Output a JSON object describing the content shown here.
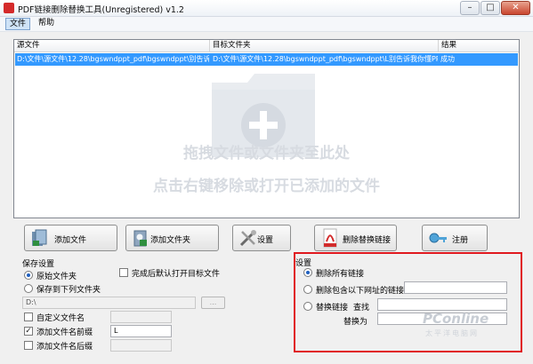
{
  "window": {
    "title": "PDF链接删除替换工具(Unregistered) v1.2",
    "minimize_glyph": "–",
    "maximize_glyph": "□",
    "close_glyph": "✕"
  },
  "menu": {
    "items": [
      "文件",
      "帮助"
    ]
  },
  "file_list": {
    "columns": [
      "源文件",
      "目标文件夹",
      "结果"
    ],
    "rows": [
      [
        "D:\\文件\\源文件\\12.28\\bgswndppt_pdf\\bgswndppt\\别告诉...",
        "D:\\文件\\源文件\\12.28\\bgswndppt_pdf\\bgswndppt\\L别告诉我你懂PP...",
        "成功"
      ]
    ],
    "drop_hint_line1": "拖拽文件或文件夹至此处",
    "drop_hint_line2": "点击右键移除或打开已添加的文件"
  },
  "toolbar": {
    "add_file": "添加文件",
    "add_folder": "添加文件夹",
    "settings": "设置",
    "delete_replace": "删除替换链接",
    "register": "注册"
  },
  "save_settings": {
    "title": "保存设置",
    "option_original": "原始文件夹",
    "option_save_to": "保存到下列文件夹",
    "open_after": "完成后默认打开目标文件",
    "folder_value": "D:\\",
    "browse_label": "...",
    "custom_filename": "自定义文件名",
    "add_prefix": "添加文件名前缀",
    "prefix_value": "L",
    "add_suffix": "添加文件名后缀"
  },
  "link_settings": {
    "title": "设置",
    "option_delete_all": "删除所有链接",
    "option_delete_containing": "删除包含以下网址的链接",
    "option_replace": "替换链接",
    "find_label": "查找",
    "replace_with_label": "替换为"
  },
  "watermark": {
    "brand": "PConline",
    "sub": "太平洋电脑网"
  },
  "colors": {
    "selection": "#3399ff",
    "highlight_box": "#e0191f"
  },
  "icons": {
    "add_file": "document-add-icon",
    "add_folder": "folder-add-icon",
    "settings": "tools-icon",
    "delete_replace": "pdf-link-icon",
    "register": "key-icon"
  }
}
